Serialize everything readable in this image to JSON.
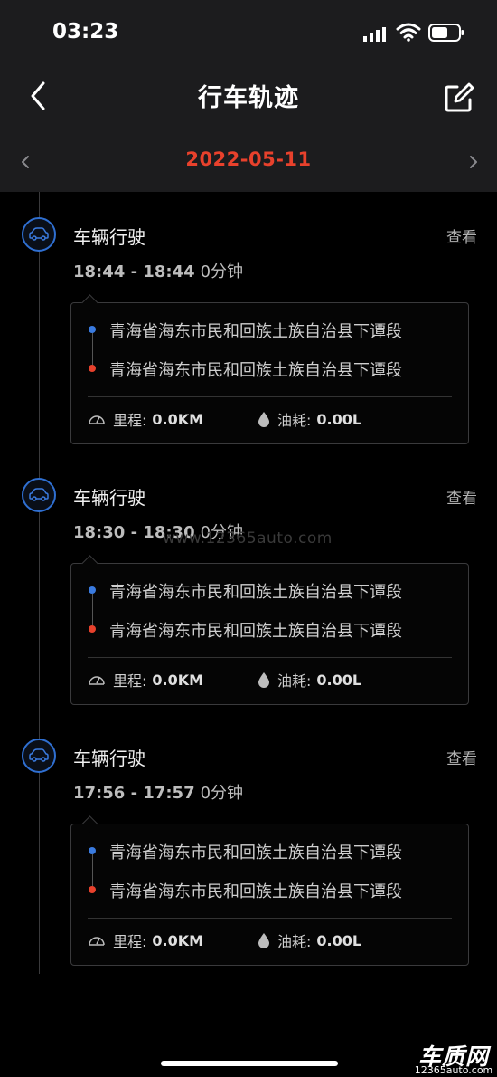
{
  "status": {
    "time": "03:23"
  },
  "header": {
    "title": "行车轨迹"
  },
  "date_nav": {
    "date": "2022-05-11"
  },
  "trips": [
    {
      "title": "车辆行驶",
      "view_label": "查看",
      "time_range": "18:44 - 18:44",
      "duration": "0分钟",
      "start_address": "青海省海东市民和回族土族自治县下谭段",
      "end_address": "青海省海东市民和回族土族自治县下谭段",
      "mileage_label": "里程:",
      "mileage_value": "0.0KM",
      "fuel_label": "油耗:",
      "fuel_value": "0.00L"
    },
    {
      "title": "车辆行驶",
      "view_label": "查看",
      "time_range": "18:30 - 18:30",
      "duration": "0分钟",
      "start_address": "青海省海东市民和回族土族自治县下谭段",
      "end_address": "青海省海东市民和回族土族自治县下谭段",
      "mileage_label": "里程:",
      "mileage_value": "0.0KM",
      "fuel_label": "油耗:",
      "fuel_value": "0.00L"
    },
    {
      "title": "车辆行驶",
      "view_label": "查看",
      "time_range": "17:56 - 17:57",
      "duration": "0分钟",
      "start_address": "青海省海东市民和回族土族自治县下谭段",
      "end_address": "青海省海东市民和回族土族自治县下谭段",
      "mileage_label": "里程:",
      "mileage_value": "0.0KM",
      "fuel_label": "油耗:",
      "fuel_value": "0.00L"
    }
  ],
  "watermark": "www.12365auto.com",
  "logo": {
    "name": "车质网",
    "url": "12365auto.com"
  },
  "colors": {
    "accent_date": "#e8412c",
    "start_dot": "#3a7be0",
    "end_dot": "#e8412c",
    "icon_ring": "#2f6fd1"
  },
  "icons": {
    "back": "chevron-left-icon",
    "edit": "edit-icon",
    "date_prev": "chevron-left-icon",
    "date_next": "chevron-right-icon",
    "trip": "car-icon",
    "mileage": "speedometer-icon",
    "fuel": "fuel-drop-icon"
  }
}
